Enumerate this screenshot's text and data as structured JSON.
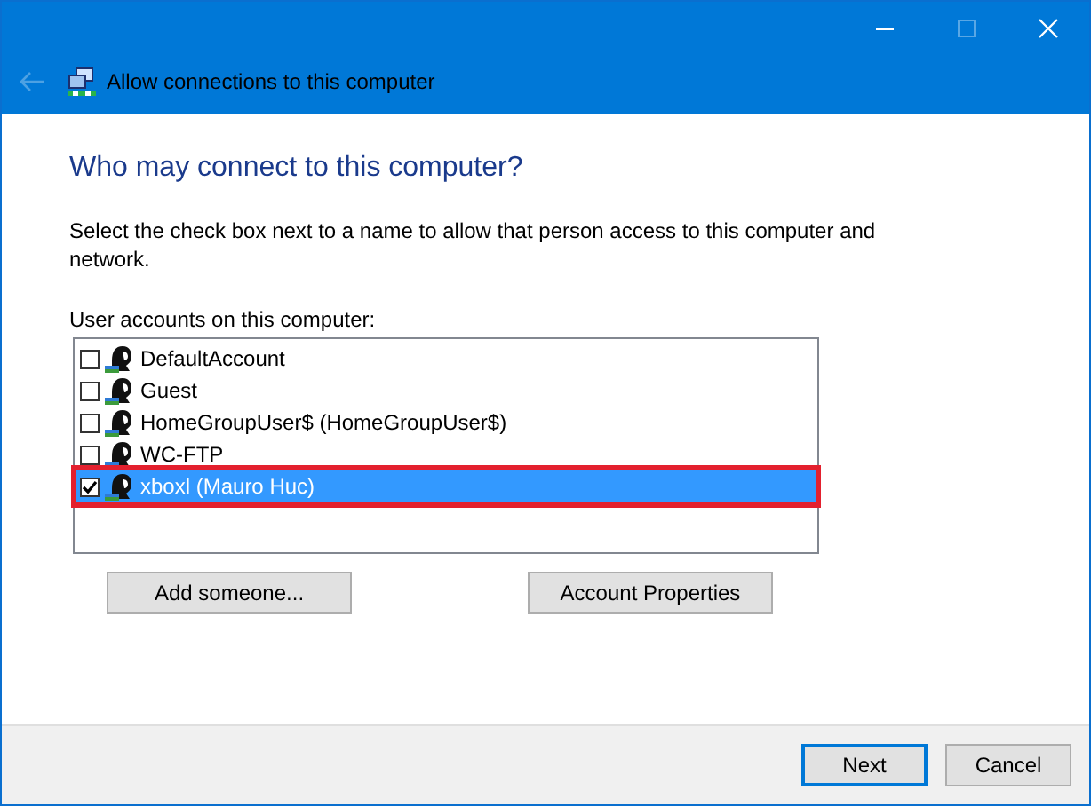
{
  "window": {
    "title": "Allow connections to this computer",
    "back_disabled": true,
    "maximize_disabled": true
  },
  "heading": "Who may connect to this computer?",
  "description": "Select the check box next to a name to allow that person access to this computer and network.",
  "accounts": {
    "label": "User accounts on this computer:",
    "items": [
      {
        "name": "DefaultAccount",
        "checked": false,
        "selected": false,
        "highlighted": false
      },
      {
        "name": "Guest",
        "checked": false,
        "selected": false,
        "highlighted": false
      },
      {
        "name": "HomeGroupUser$ (HomeGroupUser$)",
        "checked": false,
        "selected": false,
        "highlighted": false
      },
      {
        "name": "WC-FTP",
        "checked": false,
        "selected": false,
        "highlighted": false
      },
      {
        "name": "xboxl (Mauro Huc)",
        "checked": true,
        "selected": true,
        "highlighted": true
      }
    ]
  },
  "actions": [
    "Add someone...",
    "Account Properties"
  ],
  "footer_buttons": [
    {
      "label": "Next",
      "default": true
    },
    {
      "label": "Cancel",
      "default": false
    }
  ]
}
